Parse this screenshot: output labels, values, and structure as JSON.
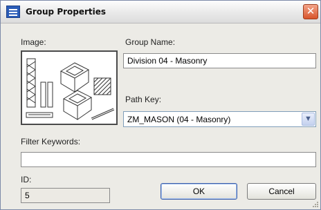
{
  "window": {
    "title": "Group Properties",
    "close_glyph": "✕"
  },
  "labels": {
    "image": "Image:",
    "group_name": "Group Name:",
    "path_key": "Path Key:",
    "filter_keywords": "Filter Keywords:",
    "id": "ID:"
  },
  "fields": {
    "group_name": "Division 04 - Masonry",
    "path_key": "ZM_MASON   (04 - Masonry)",
    "filter_keywords": "",
    "id": "5"
  },
  "buttons": {
    "ok": "OK",
    "cancel": "Cancel"
  },
  "icons": {
    "app": "window-properties-icon",
    "close": "close-icon",
    "dropdown": "chevron-down-icon",
    "preview": "masonry-blocks-illustration"
  },
  "colors": {
    "close_button": "#d8542b",
    "icon_blue": "#2a5cb8"
  }
}
